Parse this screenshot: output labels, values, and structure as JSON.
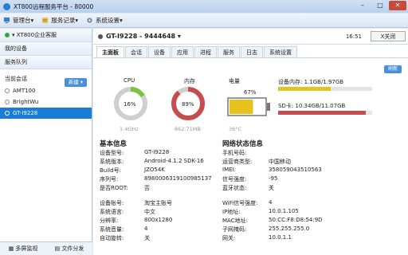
{
  "window": {
    "title": "XT800远程服务平台 - 80000",
    "min": "–",
    "max": "□",
    "close": "✕"
  },
  "menu": {
    "items": [
      {
        "label": "管理台",
        "icon": "monitor-icon"
      },
      {
        "label": "服务记录",
        "icon": "record-icon"
      },
      {
        "label": "系统设置",
        "icon": "gear-icon"
      }
    ]
  },
  "sidebar": {
    "enterprise": "XT800企业客服",
    "my_devices": "我的设备",
    "queue": "服务队列",
    "current_header": "当前会话",
    "new_button": "新建",
    "sessions": [
      {
        "label": "AMT100",
        "selected": false
      },
      {
        "label": "BrightWu",
        "selected": false
      },
      {
        "label": "GT-I9228",
        "selected": true
      }
    ],
    "bottom": {
      "multi_monitor": "多屏监视",
      "file_dist": "文件分发"
    }
  },
  "device": {
    "title": "GT-I9228 - 9444648",
    "time": "16:51",
    "close_label": "X关闭"
  },
  "tabs": [
    "主面板",
    "会话",
    "设备",
    "应用",
    "进程",
    "服务",
    "日志",
    "系统设置"
  ],
  "refresh_label": "刷新",
  "gauges": {
    "cpu": {
      "label": "CPU",
      "value": "16%",
      "sub": "1.4GHz",
      "level": 0.16,
      "color": "#7dc242"
    },
    "mem": {
      "label": "内存",
      "value": "89%",
      "sub": "862.71MB",
      "level": 0.89,
      "color": "#c84c4c"
    },
    "battery": {
      "label": "电量",
      "value": "67%",
      "sub": "36°C",
      "level": 0.67,
      "color": "#e7c21c"
    }
  },
  "storage": {
    "internal": {
      "label": "设备内存: 1.1GB/1.97GB",
      "level": 0.56,
      "color": "#e7c21c"
    },
    "sd": {
      "label": "SD卡: 10.34GB/11.07GB",
      "level": 0.93,
      "color": "#c84c4c"
    }
  },
  "basic_title": "基本信息",
  "network_title": "网络状态信息",
  "basic": [
    {
      "k": "设备型号:",
      "v": "GT-I9228"
    },
    {
      "k": "系统版本:",
      "v": "Android-4.1.2  SDK-16"
    },
    {
      "k": "Build号:",
      "v": "JZO54K"
    },
    {
      "k": "序列号:",
      "v": "8980006319100985137"
    },
    {
      "k": "是否ROOT:",
      "v": "否"
    }
  ],
  "basic2": [
    {
      "k": "设备账号:",
      "v": "淘宝主账号"
    },
    {
      "k": "系统语言:",
      "v": "中文"
    },
    {
      "k": "分辨率:",
      "v": "800x1280"
    },
    {
      "k": "系统音量:",
      "v": "4"
    },
    {
      "k": "自动旋转:",
      "v": "关"
    }
  ],
  "network": [
    {
      "k": "手机号码:",
      "v": ""
    },
    {
      "k": "运营商类型:",
      "v": "中国移动"
    },
    {
      "k": "IMEI:",
      "v": "358059043510563"
    },
    {
      "k": "信号强度:",
      "v": "-95"
    },
    {
      "k": "蓝牙状态:",
      "v": "关"
    }
  ],
  "network2": [
    {
      "k": "WiFi信号强度:",
      "v": "4"
    },
    {
      "k": "IP地址:",
      "v": "10.0.1.105"
    },
    {
      "k": "MAC地址:",
      "v": "50:CC:F8:D8:54:9D"
    },
    {
      "k": "子网掩码:",
      "v": "255.255.255.0"
    },
    {
      "k": "网关:",
      "v": "10.0.1.1"
    }
  ]
}
